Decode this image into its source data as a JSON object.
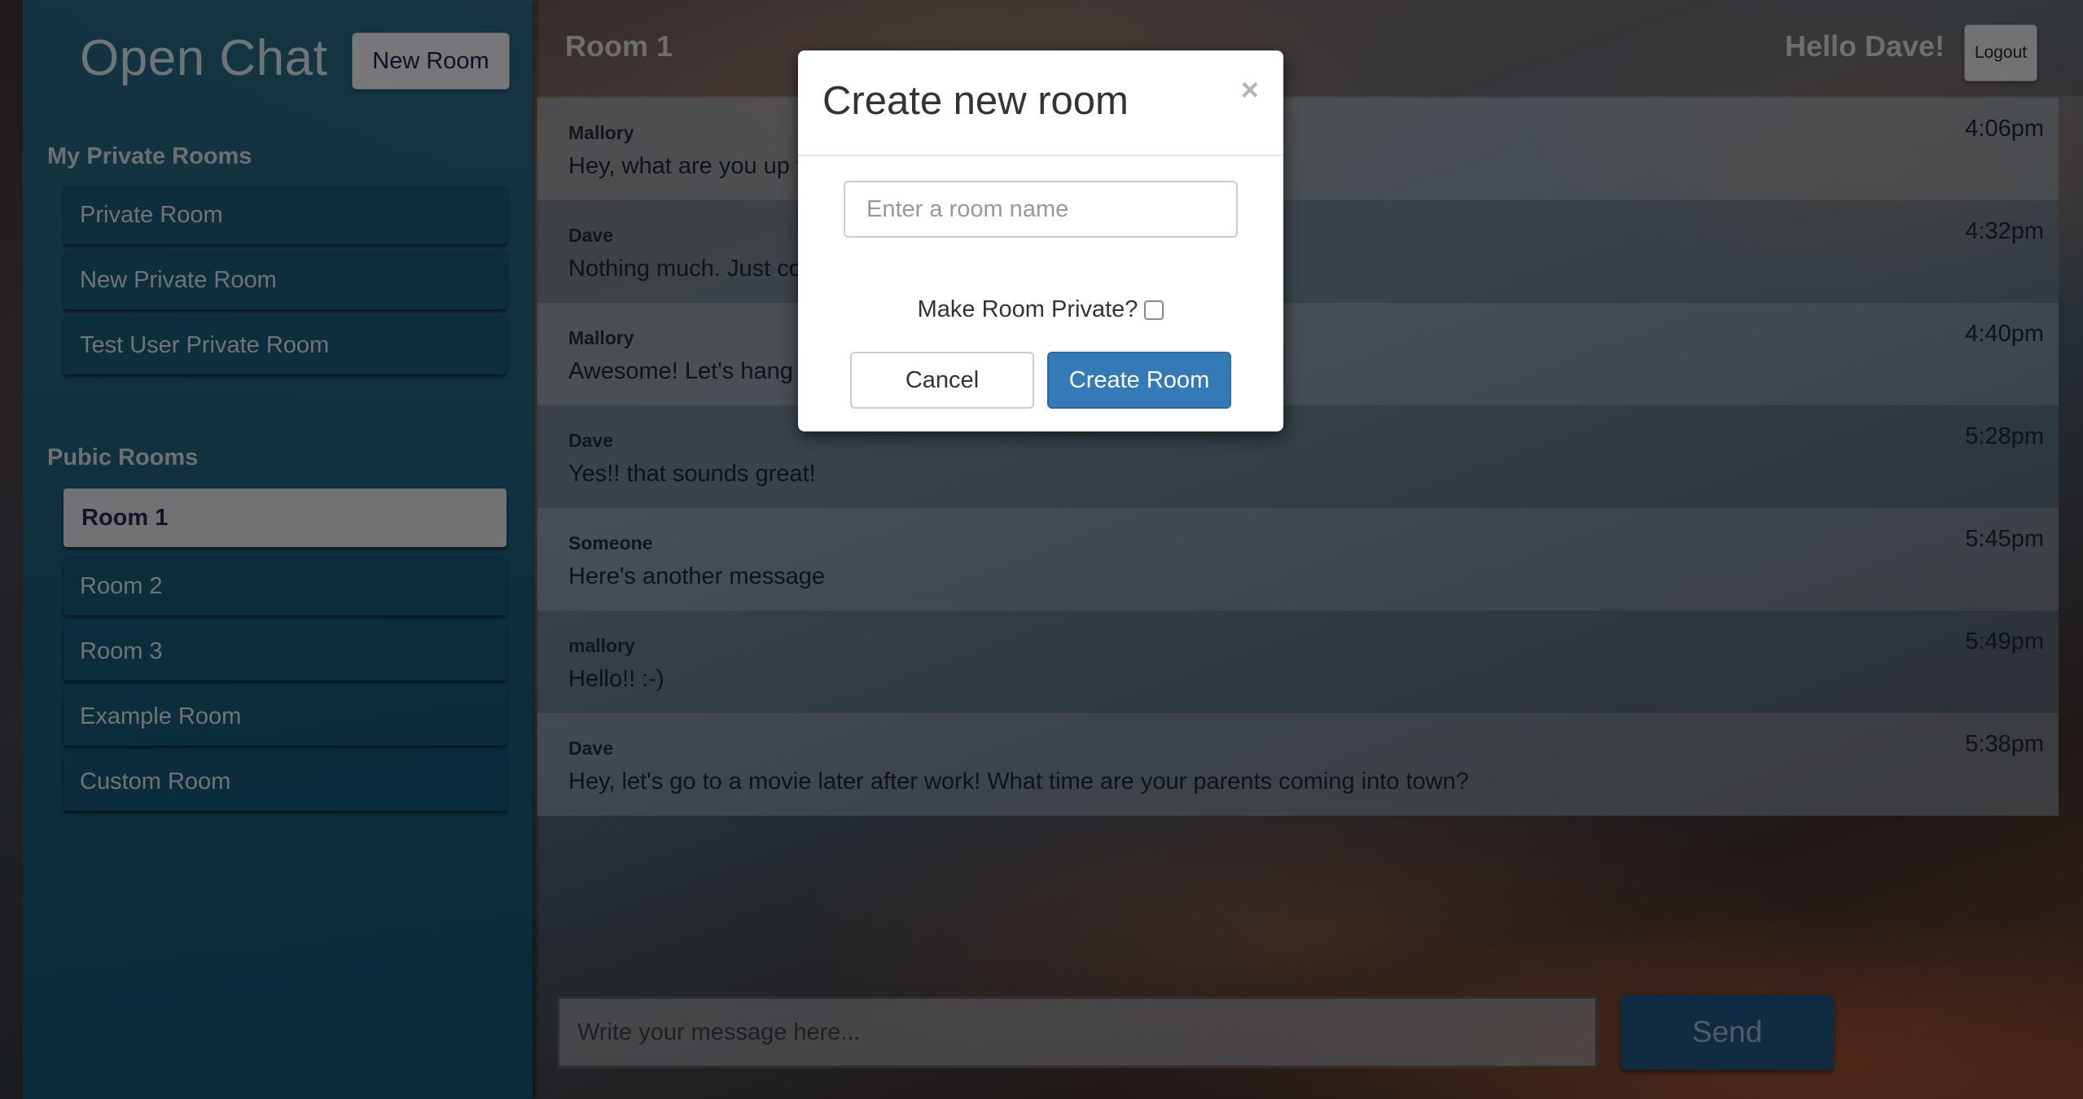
{
  "app": {
    "title": "Open Chat",
    "new_room_label": "New Room"
  },
  "sidebar": {
    "private_section_title": "My Private Rooms",
    "private_rooms": [
      "Private Room",
      "New Private Room",
      "Test User Private Room"
    ],
    "public_section_title": "Pubic Rooms",
    "public_rooms": [
      "Room 1",
      "Room 2",
      "Room 3",
      "Example Room",
      "Custom Room"
    ],
    "active_room": "Room 1"
  },
  "header": {
    "room_title": "Room 1",
    "greeting": "Hello Dave!",
    "logout_label": "Logout"
  },
  "messages": [
    {
      "author": "Mallory",
      "text": "Hey, what are you up to?",
      "time": "4:06pm"
    },
    {
      "author": "Dave",
      "text": "Nothing much. Just coding.",
      "time": "4:32pm"
    },
    {
      "author": "Mallory",
      "text": "Awesome! Let's hang out later!",
      "time": "4:40pm"
    },
    {
      "author": "Dave",
      "text": "Yes!! that sounds great!",
      "time": "5:28pm"
    },
    {
      "author": "Someone",
      "text": "Here's another message",
      "time": "5:45pm"
    },
    {
      "author": "mallory",
      "text": "Hello!! :-)",
      "time": "5:49pm"
    },
    {
      "author": "Dave",
      "text": "Hey, let's go to a movie later after work! What time are your parents coming into town?",
      "time": "5:38pm"
    }
  ],
  "composer": {
    "placeholder": "Write your message here...",
    "send_label": "Send"
  },
  "modal": {
    "title": "Create new room",
    "close_glyph": "×",
    "room_name_placeholder": "Enter a room name",
    "private_label": "Make Room Private?",
    "cancel_label": "Cancel",
    "create_label": "Create Room"
  },
  "colors": {
    "sidebar_bg": "#1a5674",
    "primary_button": "#337ab7",
    "send_button": "#1f4f7a"
  }
}
